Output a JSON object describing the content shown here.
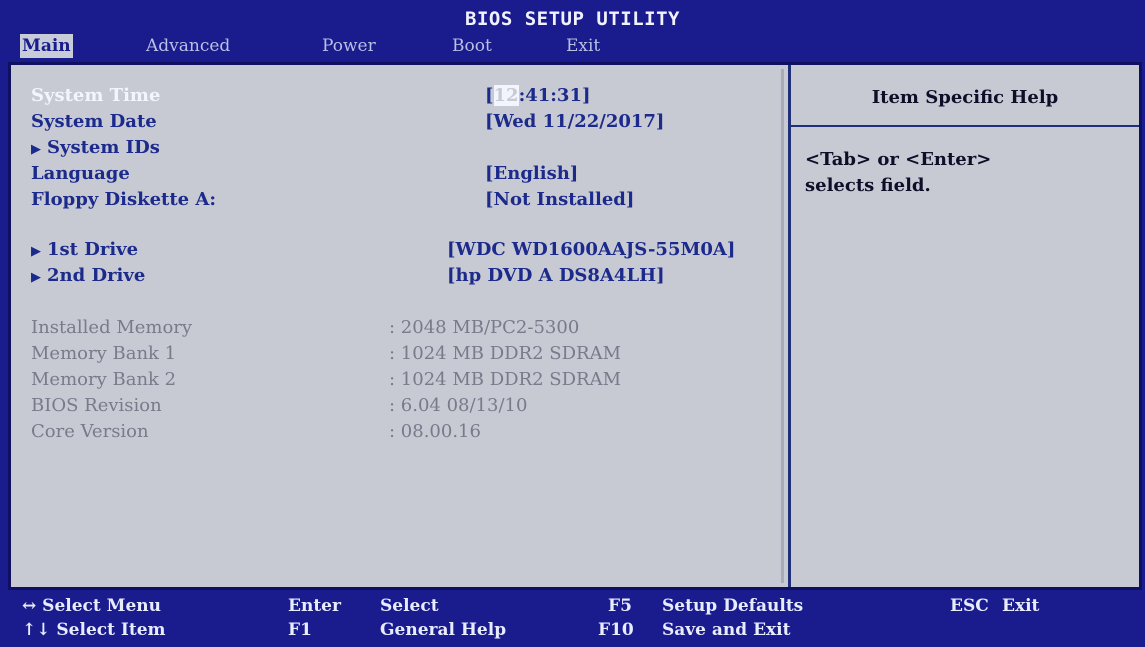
{
  "title": "BIOS SETUP UTILITY",
  "menu": [
    {
      "label": "Main"
    },
    {
      "label": "Advanced"
    },
    {
      "label": "Power"
    },
    {
      "label": "Boot"
    },
    {
      "label": "Exit"
    }
  ],
  "settings": [
    {
      "label": "System Time",
      "value_prefix": "[",
      "value_hl": "12",
      "value_rest": ":41:31]"
    },
    {
      "label": "System Date",
      "value": "[Wed 11/22/2017]"
    },
    {
      "label": "System IDs"
    },
    {
      "label": "Language",
      "value": "[English]"
    },
    {
      "label": "Floppy Diskette A:",
      "value": "[Not Installed]"
    },
    {
      "label": "1st Drive",
      "value": "[WDC WD1600AAJS-55M0A]"
    },
    {
      "label": "2nd Drive",
      "value": "[hp DVD A DS8A4LH]"
    }
  ],
  "info": [
    {
      "label": "Installed Memory",
      "value": ": 2048 MB/PC2-5300"
    },
    {
      "label": "Memory Bank 1",
      "value": ": 1024 MB DDR2 SDRAM"
    },
    {
      "label": "Memory Bank 2",
      "value": ": 1024 MB DDR2 SDRAM"
    },
    {
      "label": "BIOS Revision",
      "value": ": 6.04 08/13/10"
    },
    {
      "label": "Core Version",
      "value": ": 08.00.16"
    }
  ],
  "help": {
    "title": "Item Specific Help",
    "line1": "<Tab> or <Enter>",
    "line2": "selects field."
  },
  "footer": {
    "select_menu": "↔ Select Menu",
    "select_item": "↑↓ Select Item",
    "enter_key": "Enter",
    "enter_label": "Select",
    "f1_key": "F1",
    "f1_label": "General Help",
    "f5_key": "F5",
    "f5_label": "Setup Defaults",
    "f10_key": "F10",
    "f10_label": "Save and Exit",
    "esc_key": "ESC",
    "esc_label": "Exit"
  },
  "colors": {
    "background": "#1a1c8e",
    "panel": "#c7cad3",
    "text_blue": "#1c2a8c",
    "text_gray": "#777b8a",
    "highlight": "#f4f4ff"
  }
}
